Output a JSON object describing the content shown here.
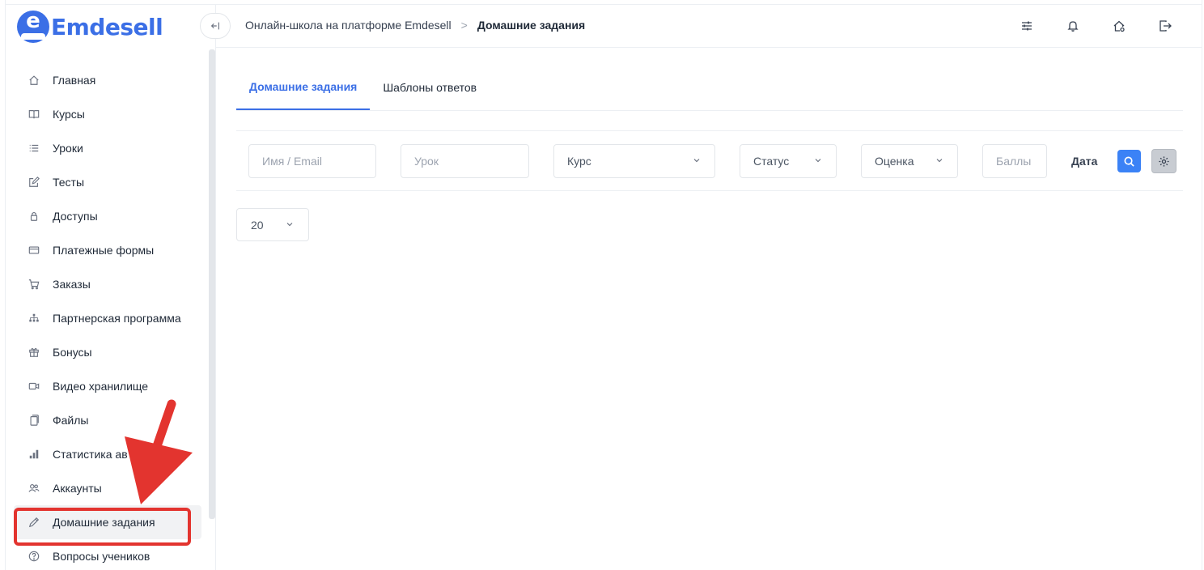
{
  "logo": {
    "letter": "e",
    "name": "Emdesell"
  },
  "header": {
    "breadcrumb_parent": "Онлайн-школа на платформе Emdesell",
    "breadcrumb_separator": ">",
    "breadcrumb_current": "Домашние задания",
    "icons": [
      "sliders-icon",
      "bell-icon",
      "home-settings-icon",
      "logout-icon"
    ]
  },
  "sidebar": {
    "items": [
      {
        "label": "Главная",
        "icon": "home-icon"
      },
      {
        "label": "Курсы",
        "icon": "book-icon"
      },
      {
        "label": "Уроки",
        "icon": "list-icon"
      },
      {
        "label": "Тесты",
        "icon": "edit-icon"
      },
      {
        "label": "Доступы",
        "icon": "lock-icon"
      },
      {
        "label": "Платежные формы",
        "icon": "credit-card-icon"
      },
      {
        "label": "Заказы",
        "icon": "cart-icon"
      },
      {
        "label": "Партнерская программа",
        "icon": "hierarchy-icon"
      },
      {
        "label": "Бонусы",
        "icon": "gift-icon"
      },
      {
        "label": "Видео хранилище",
        "icon": "video-icon"
      },
      {
        "label": "Файлы",
        "icon": "files-icon"
      },
      {
        "label": "Статистика ав",
        "icon": "chart-icon"
      },
      {
        "label": "Аккаунты",
        "icon": "users-icon"
      },
      {
        "label": "Домашние задания",
        "icon": "pencil-icon",
        "active": true
      },
      {
        "label": "Вопросы учеников",
        "icon": "question-icon"
      }
    ]
  },
  "tabs": [
    {
      "label": "Домашние задания",
      "active": true
    },
    {
      "label": "Шаблоны ответов",
      "active": false
    }
  ],
  "filters": {
    "name_placeholder": "Имя / Email",
    "lesson_placeholder": "Урок",
    "course_label": "Курс",
    "status_label": "Статус",
    "grade_label": "Оценка",
    "points_placeholder": "Баллы",
    "date_label": "Дата"
  },
  "pagination": {
    "per_page": "20"
  },
  "colors": {
    "accent": "#3b6fe6",
    "search_button": "#3b82f6",
    "highlight": "#e3342f"
  }
}
